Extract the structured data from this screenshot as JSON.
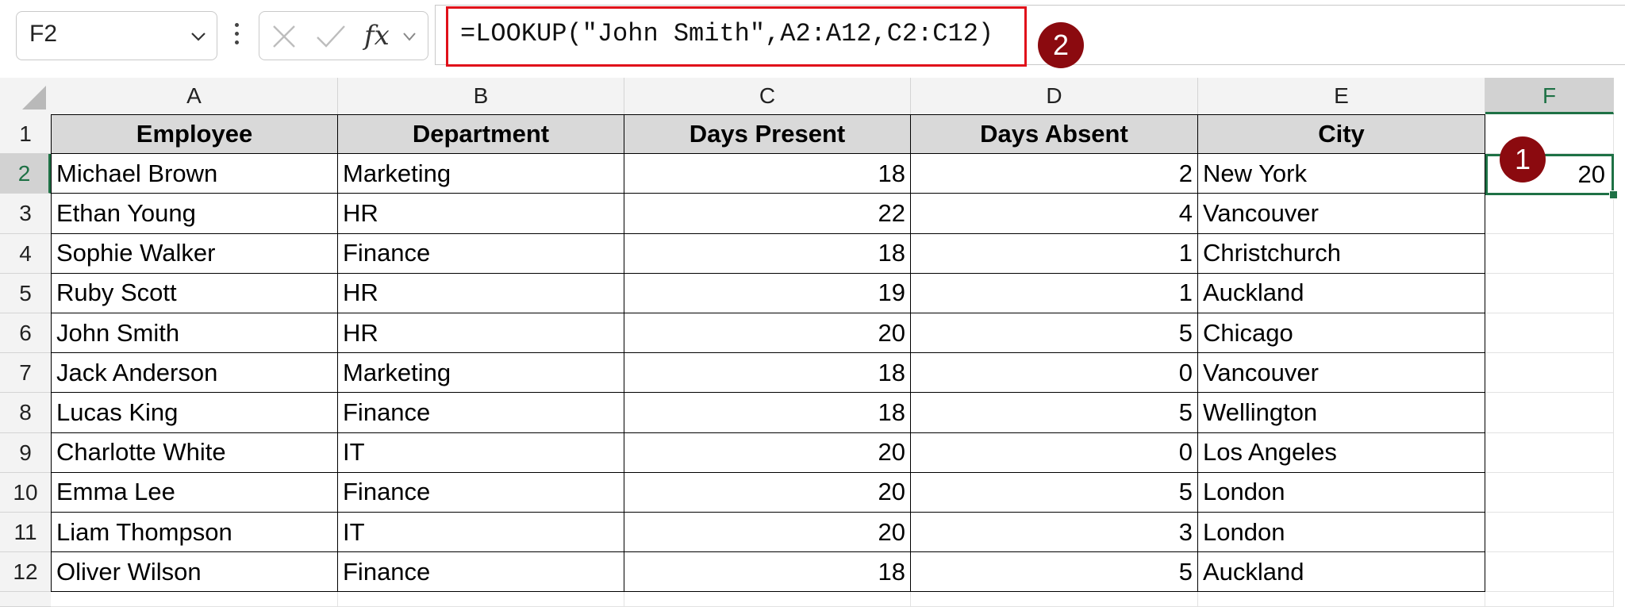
{
  "name_box": {
    "value": "F2",
    "chevron_icon": "chevron-down-icon"
  },
  "formula_bar": {
    "cancel_icon": "cancel-x-icon",
    "enter_icon": "checkmark-icon",
    "fx_label": "fx",
    "formula": "=LOOKUP(\"John Smith\",A2:A12,C2:C12)"
  },
  "badges": {
    "result_badge": "1",
    "formula_badge": "2"
  },
  "column_headers": [
    "A",
    "B",
    "C",
    "D",
    "E",
    "F"
  ],
  "selected_column": "F",
  "row_headers": [
    "1",
    "2",
    "3",
    "4",
    "5",
    "6",
    "7",
    "8",
    "9",
    "10",
    "11",
    "12"
  ],
  "selected_row": "2",
  "table": {
    "headers": [
      "Employee",
      "Department",
      "Days Present",
      "Days Absent",
      "City"
    ],
    "rows": [
      [
        "Michael Brown",
        "Marketing",
        "18",
        "2",
        "New York"
      ],
      [
        "Ethan Young",
        "HR",
        "22",
        "4",
        "Vancouver"
      ],
      [
        "Sophie Walker",
        "Finance",
        "18",
        "1",
        "Christchurch"
      ],
      [
        "Ruby Scott",
        "HR",
        "19",
        "1",
        "Auckland"
      ],
      [
        "John Smith",
        "HR",
        "20",
        "5",
        "Chicago"
      ],
      [
        "Jack Anderson",
        "Marketing",
        "18",
        "0",
        "Vancouver"
      ],
      [
        "Lucas King",
        "Finance",
        "18",
        "5",
        "Wellington"
      ],
      [
        "Charlotte White",
        "IT",
        "20",
        "0",
        "Los Angeles"
      ],
      [
        "Emma Lee",
        "Finance",
        "20",
        "5",
        "London"
      ],
      [
        "Liam Thompson",
        "IT",
        "20",
        "3",
        "London"
      ],
      [
        "Oliver Wilson",
        "Finance",
        "18",
        "5",
        "Auckland"
      ]
    ]
  },
  "active_cell": {
    "ref": "F2",
    "value": "20"
  },
  "colors": {
    "selection": "#1e7145",
    "highlight": "#e0101a",
    "badge": "#8b0a0f",
    "header_fill": "#d9d9d9"
  }
}
